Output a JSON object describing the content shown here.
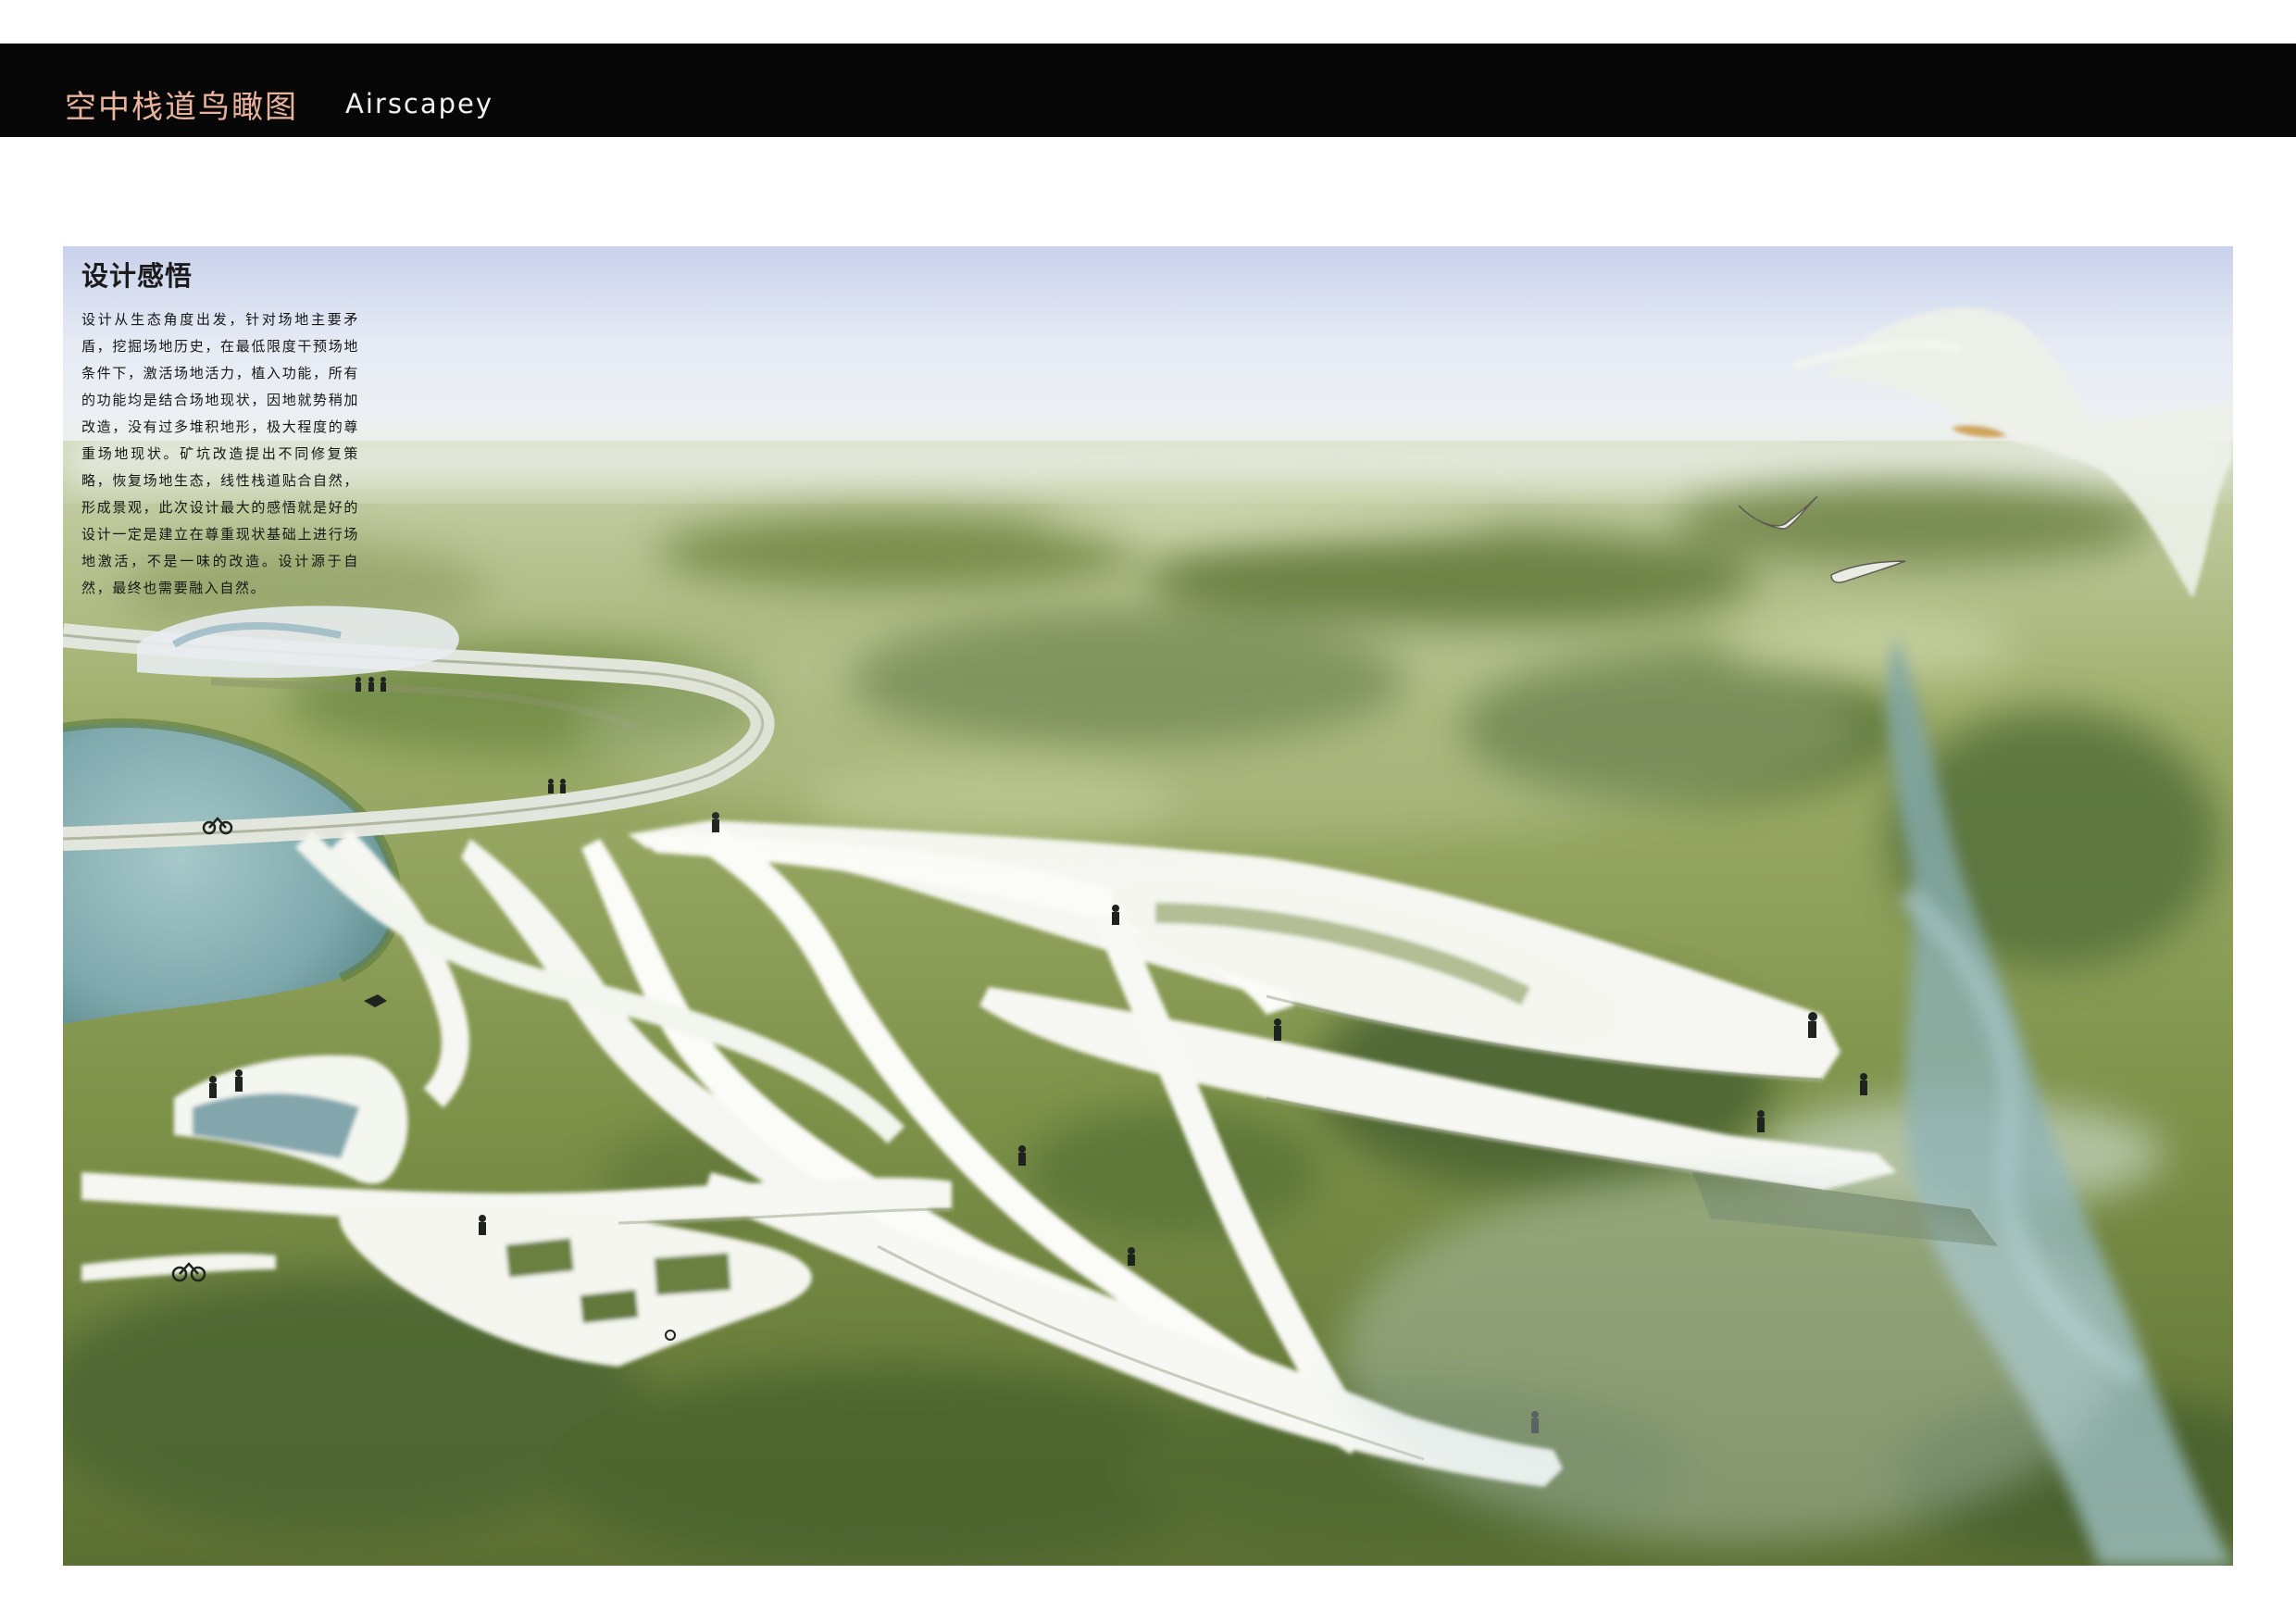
{
  "header": {
    "title_cn": "空中栈道鸟瞰图",
    "title_en": "Airscapey"
  },
  "text_panel": {
    "heading": "设计感悟",
    "body": "设计从生态角度出发，针对场地主要矛盾，挖掘场地历史，在最低限度干预场地条件下，激活场地活力，植入功能，所有的功能均是结合场地现状，因地就势稍加改造，没有过多堆积地形，极大程度的尊重场地现状。矿坑改造提出不同修复策略，恢复场地生态，线性栈道贴合自然，形成景观，此次设计最大的感悟就是好的设计一定是建立在尊重现状基础上进行场地激活，不是一味的改造。设计源于自然，最终也需要融入自然。"
  },
  "colors": {
    "title_bar": "#070707",
    "title_cn": "#e9b39d",
    "title_en": "#f2f2f2",
    "vegetation_dark": "#4f6a2e",
    "vegetation_mid": "#8ea05a",
    "vegetation_light": "#c6cf95",
    "water": "#7aa7ab",
    "sky": "#cfd8ec",
    "walkway": "#f6f7f2"
  }
}
